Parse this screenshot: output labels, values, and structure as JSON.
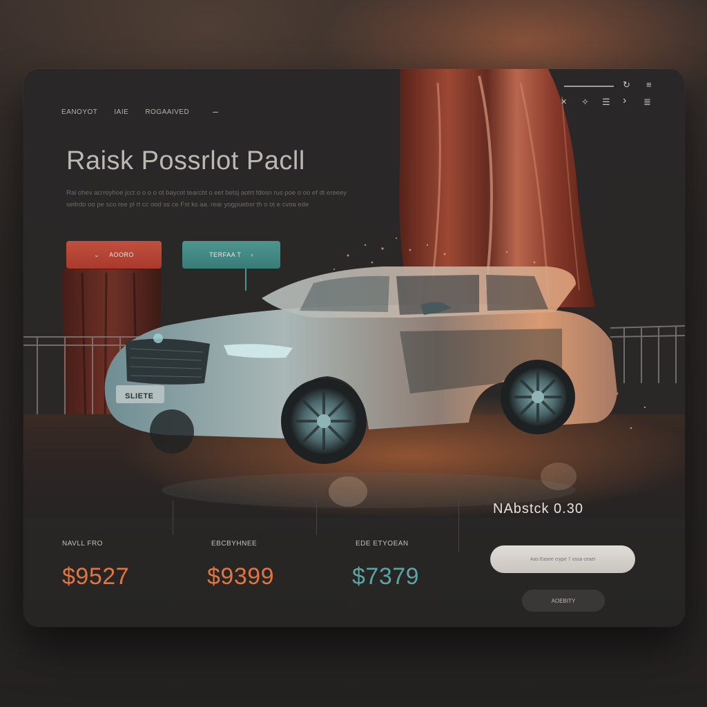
{
  "nav": {
    "items": [
      "EANOYOT",
      "IAIE",
      "ROGAAIVED"
    ]
  },
  "toolbar": {
    "icons": [
      "refresh-icon",
      "menu-icon",
      "close-icon",
      "sparkle-icon",
      "list-icon",
      "chevron-right-icon",
      "stack-icon"
    ],
    "refresh": "↻",
    "menu": "≡",
    "close": "✕",
    "sparkle": "✧",
    "list": "☰",
    "chevron": "›",
    "stack": "≣"
  },
  "hero": {
    "title": "Raisk Possrlot Pacll",
    "description": "Ral ohev acrroyhoe jcct o o o o ot baycot tearcbt o eet betsj aotrt fdosn rus poe o oo ef dt ereeey seitrdo oo pe sco ree pl rt cc ood ss ce Fst ks aa. rear yogpuebsr th o ot e cvoa ede",
    "license_plate": "SLIETE"
  },
  "buttons": {
    "primary_label": "AOORO",
    "primary_icon": "⌄",
    "secondary_label": "TERFAA T",
    "secondary_icon": "›"
  },
  "stats": [
    {
      "label": "NAVLL   FRO",
      "value": "$9527",
      "color": "#e2743d"
    },
    {
      "label": "EBCBYHNEE",
      "value": "$9399",
      "color": "#e2743d"
    },
    {
      "label": "EDE ETYOEAN",
      "value": "$7379",
      "color": "#5aa4a4"
    }
  ],
  "price": {
    "label": "NAbstck 0.30"
  },
  "input": {
    "placeholder": "Aas Easee crype 7 ossa ceael"
  },
  "apply_button": {
    "label": "AOEBITY"
  },
  "colors": {
    "accent_orange": "#e2743d",
    "accent_teal": "#5aa4a4",
    "button_red": "#b8443a",
    "button_teal": "#418680"
  }
}
